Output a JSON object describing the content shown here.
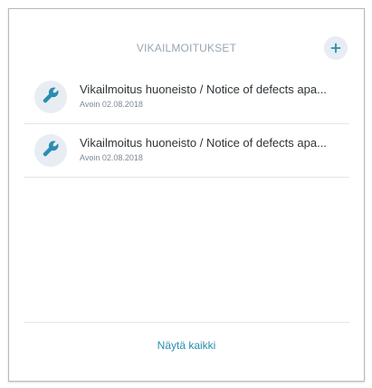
{
  "header": {
    "title": "VIKAILMOITUKSET",
    "add_icon": "plus-icon",
    "accent_color": "#2a8db0"
  },
  "items": [
    {
      "icon": "wrench-icon",
      "title": "Vikailmoitus huoneisto / Notice of defects apa...",
      "subtitle": "Avoin 02.08.2018"
    },
    {
      "icon": "wrench-icon",
      "title": "Vikailmoitus huoneisto / Notice of defects apa...",
      "subtitle": "Avoin 02.08.2018"
    }
  ],
  "footer": {
    "show_all_label": "Näytä kaikki"
  }
}
